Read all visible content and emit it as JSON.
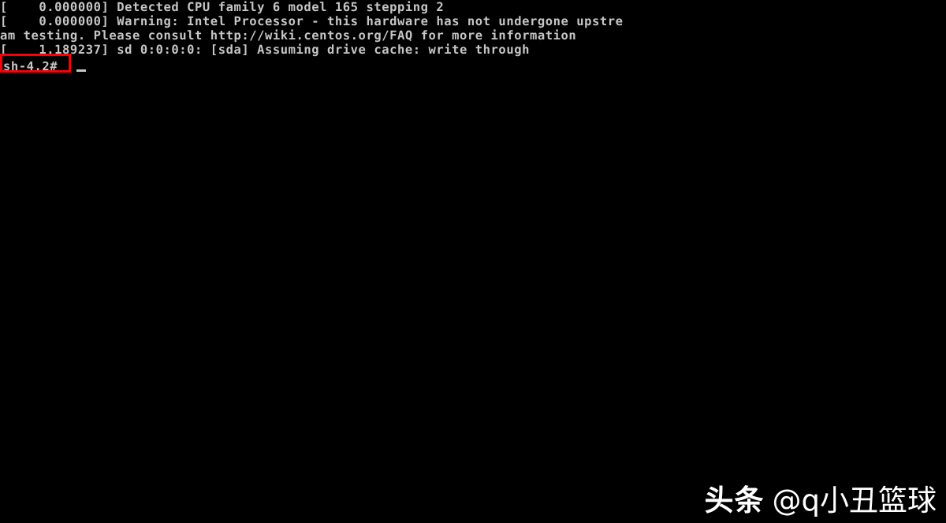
{
  "terminal": {
    "background_color": "#000000",
    "text_color": "#c6c6c6",
    "lines": [
      "[    0.000000] Detected CPU family 6 model 165 stepping 2",
      "[    0.000000] Warning: Intel Processor - this hardware has not undergone upstre",
      "am testing. Please consult http://wiki.centos.org/FAQ for more information",
      "[    1.189237] sd 0:0:0:0: [sda] Assuming drive cache: write through"
    ],
    "prompt": "sh-4.2#",
    "cursor": "_"
  },
  "annotation": {
    "highlight_color": "#fb0007",
    "target": "sh-4.2#"
  },
  "watermark": {
    "brand": "头条",
    "handle": "@q小丑篮球"
  }
}
